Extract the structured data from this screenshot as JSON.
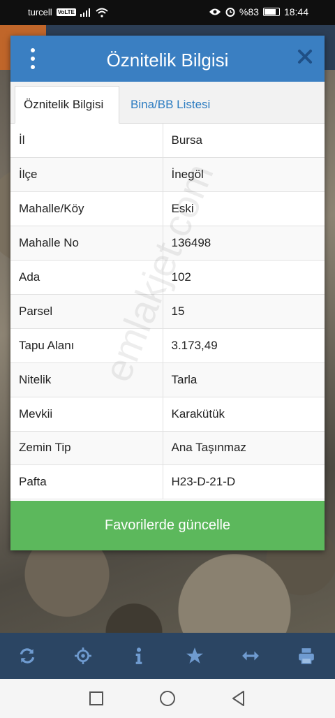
{
  "status_bar": {
    "carrier": "turcell",
    "network_badge": "VoLTE",
    "battery": "%83",
    "battery_level": 0.83,
    "time": "18:44"
  },
  "dialog": {
    "title": "Öznitelik Bilgisi",
    "tabs": [
      {
        "label": "Öznitelik Bilgisi",
        "active": true
      },
      {
        "label": "Bina/BB Listesi",
        "active": false
      }
    ],
    "rows": [
      {
        "key": "İl",
        "value": "Bursa"
      },
      {
        "key": "İlçe",
        "value": "İnegöl"
      },
      {
        "key": "Mahalle/Köy",
        "value": "Eski"
      },
      {
        "key": "Mahalle No",
        "value": "136498"
      },
      {
        "key": "Ada",
        "value": "102"
      },
      {
        "key": "Parsel",
        "value": "15"
      },
      {
        "key": "Tapu Alanı",
        "value": "3.173,49"
      },
      {
        "key": "Nitelik",
        "value": "Tarla"
      },
      {
        "key": "Mevkii",
        "value": "Karakütük"
      },
      {
        "key": "Zemin Tip",
        "value": "Ana Taşınmaz"
      },
      {
        "key": "Pafta",
        "value": "H23-D-21-D"
      }
    ],
    "update_button": "Favorilerde güncelle"
  },
  "watermark": "emlakjet.com",
  "toolbar": {
    "icons": [
      "refresh-icon",
      "locate-icon",
      "info-icon",
      "star-icon",
      "measure-icon",
      "print-icon"
    ]
  },
  "nav": {
    "icons": [
      "recents-icon",
      "home-icon",
      "back-icon"
    ]
  },
  "colors": {
    "header": "#3a7fc2",
    "tab_link": "#2c7cc1",
    "button": "#5cb85c",
    "toolbar": "#2b4563"
  }
}
